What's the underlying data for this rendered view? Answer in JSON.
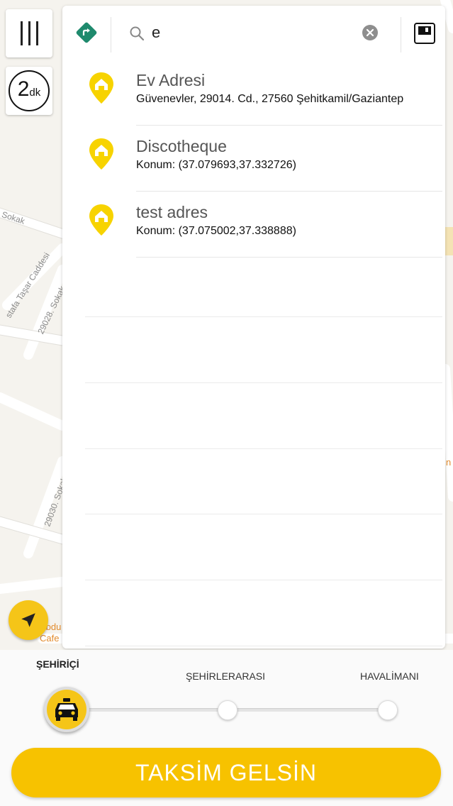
{
  "map": {
    "street_labels": [
      "Sokak",
      "stafa Taşar Caddesi",
      "29028. Sokak",
      "29030. Sokak"
    ],
    "cafe_label": [
      "Abdu",
      "Cafe"
    ],
    "partial_label_right": "n"
  },
  "controls": {
    "menu_icon": "hamburger-vertical-icon",
    "eta_number": "2",
    "eta_unit": "dk",
    "locate_icon": "navigation-arrow-icon"
  },
  "search": {
    "query": "e",
    "route_icon": "route-turn-icon",
    "search_icon": "magnifier-icon",
    "clear_icon": "clear-circle-icon",
    "save_icon": "floppy-save-icon"
  },
  "results": [
    {
      "title": "Ev Adresi",
      "subtitle": "Güvenevler, 29014. Cd., 27560 Şehitkamil/Gaziantep"
    },
    {
      "title": "Discotheque",
      "subtitle": "Konum: (37.079693,37.332726)"
    },
    {
      "title": "test adres",
      "subtitle": "Konum: (37.075002,37.338888)"
    }
  ],
  "service_types": {
    "categories": [
      "ŞEHİRİÇİ",
      "ŞEHİRLERARASI",
      "HAVALİMANI"
    ],
    "selected": "ŞEHİRİÇİ",
    "taxi_icon": "taxi-icon"
  },
  "cta": {
    "label": "TAKSİM GELSİN"
  },
  "colors": {
    "accent_yellow": "#f7c200",
    "route_green": "#1f8a6d",
    "pin_yellow": "#f7d300"
  }
}
